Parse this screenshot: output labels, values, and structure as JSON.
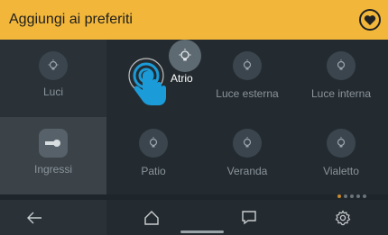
{
  "header": {
    "title": "Aggiungi ai preferiti",
    "favorite_icon": "heart-icon"
  },
  "sidebar": {
    "categories": [
      {
        "label": "Luci",
        "icon": "bulb-icon",
        "selected": false
      },
      {
        "label": "Ingressi",
        "icon": "key-lock-icon",
        "selected": true
      }
    ]
  },
  "grid": {
    "tiles": [
      {
        "label": "Atrio",
        "icon": "bulb-icon",
        "state": "being-dragged"
      },
      {
        "label": "Luce esterna",
        "icon": "bulb-icon"
      },
      {
        "label": "Luce interna",
        "icon": "bulb-icon"
      },
      {
        "label": "Patio",
        "icon": "bulb-icon"
      },
      {
        "label": "Veranda",
        "icon": "bulb-icon"
      },
      {
        "label": "Vialetto",
        "icon": "bulb-icon"
      }
    ]
  },
  "drag": {
    "label": "Atrio",
    "gesture_icon": "tap-hand-icon"
  },
  "pagination": {
    "pages": 5,
    "current": 1
  },
  "bottom_nav": {
    "items": [
      {
        "name": "back",
        "icon": "back-arrow-icon"
      },
      {
        "name": "home",
        "icon": "home-icon"
      },
      {
        "name": "messages",
        "icon": "chat-icon"
      },
      {
        "name": "settings",
        "icon": "gear-icon"
      }
    ]
  },
  "colors": {
    "accent": "#f2b73a",
    "background": "#1f262b",
    "icon_circle": "#3a454d",
    "pagination_active": "#c98a2a",
    "hand": "#1b9bd7"
  }
}
